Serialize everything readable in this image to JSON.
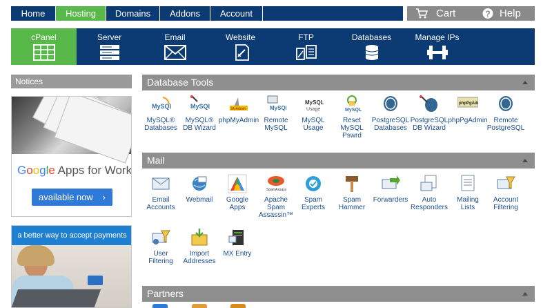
{
  "topnav": {
    "items": [
      {
        "label": "Home",
        "active": false
      },
      {
        "label": "Hosting",
        "active": true
      },
      {
        "label": "Domains",
        "active": false
      },
      {
        "label": "Addons",
        "active": false
      },
      {
        "label": "Account",
        "active": false
      }
    ],
    "cart_label": "Cart",
    "help_label": "Help"
  },
  "categories": [
    {
      "label": "cPanel",
      "icon": "cpanel-grid-icon",
      "active": true
    },
    {
      "label": "Server",
      "icon": "server-rack-icon",
      "active": false
    },
    {
      "label": "Email",
      "icon": "envelope-icon",
      "active": false
    },
    {
      "label": "Website",
      "icon": "website-document-icon",
      "active": false
    },
    {
      "label": "FTP",
      "icon": "ftp-transfer-icon",
      "active": false
    },
    {
      "label": "Databases",
      "icon": "database-icon",
      "active": false
    },
    {
      "label": "Manage IPs",
      "icon": "ip-connector-icon",
      "active": false
    }
  ],
  "sidebar": {
    "notices_label": "Notices",
    "ad1": {
      "google": {
        "G": "G",
        "o1": "o",
        "o2": "o",
        "g": "g",
        "l": "l",
        "e": "e"
      },
      "tagline": " Apps for Work",
      "button_label": "available now",
      "chevron": "›"
    },
    "ad2": {
      "headline": "a better way to accept payments"
    }
  },
  "sections": {
    "database_tools": {
      "title": "Database Tools",
      "items": [
        {
          "label": "MySQL®\nDatabases",
          "icon": "mysql-databases-icon"
        },
        {
          "label": "MySQL®\nDB Wizard",
          "icon": "mysql-wizard-icon"
        },
        {
          "label": "phpMyAdmin",
          "icon": "phpmyadmin-icon"
        },
        {
          "label": "Remote\nMySQL",
          "icon": "remote-mysql-icon"
        },
        {
          "label": "MySQL\nUsage",
          "icon": "mysql-usage-icon"
        },
        {
          "label": "Reset\nMySQL\nPswrd",
          "icon": "reset-mysql-password-icon"
        },
        {
          "label": "PostgreSQL\nDatabases",
          "icon": "postgresql-databases-icon"
        },
        {
          "label": "PostgreSQL\nDB Wizard",
          "icon": "postgresql-wizard-icon"
        },
        {
          "label": "phpPgAdmin",
          "icon": "phppgadmin-icon"
        },
        {
          "label": "Remote\nPostgreSQL",
          "icon": "remote-postgresql-icon"
        }
      ]
    },
    "mail": {
      "title": "Mail",
      "items": [
        {
          "label": "Email\nAccounts",
          "icon": "email-accounts-icon"
        },
        {
          "label": "Webmail",
          "icon": "webmail-icon"
        },
        {
          "label": "Google\nApps",
          "icon": "google-apps-icon"
        },
        {
          "label": "Apache\nSpam\nAssassin™",
          "icon": "spamassassin-icon"
        },
        {
          "label": "Spam\nExperts",
          "icon": "spam-experts-icon"
        },
        {
          "label": "Spam\nHammer",
          "icon": "spam-hammer-icon"
        },
        {
          "label": "Forwarders",
          "icon": "forwarders-icon"
        },
        {
          "label": "Auto\nResponders",
          "icon": "auto-responders-icon"
        },
        {
          "label": "Mailing\nLists",
          "icon": "mailing-lists-icon"
        },
        {
          "label": "Account\nFiltering",
          "icon": "account-filtering-icon"
        },
        {
          "label": "User\nFiltering",
          "icon": "user-filtering-icon"
        },
        {
          "label": "Import\nAddresses",
          "icon": "import-addresses-icon"
        },
        {
          "label": "MX Entry",
          "icon": "mx-entry-icon"
        }
      ]
    },
    "partners": {
      "title": "Partners"
    }
  },
  "colors": {
    "nav_blue": "#0c3a73",
    "accent_green": "#59b84a",
    "section_gray": "#8f8f8f",
    "link_blue": "#1b4f8f"
  }
}
